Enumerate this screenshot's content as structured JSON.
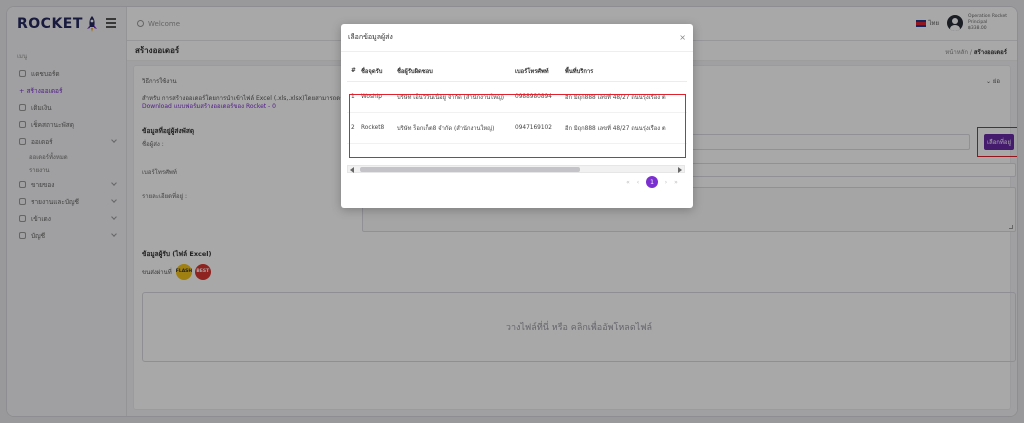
{
  "brand": {
    "name": "ROCKET"
  },
  "topbar": {
    "search_label": "Welcome",
    "language": "ไทย",
    "user": {
      "line1": "Operation Rocket",
      "line2": "Principal",
      "line3": "฿338.00"
    }
  },
  "sidebar": {
    "section_label": "เมนู",
    "items": [
      {
        "label": "แดชบอร์ด"
      },
      {
        "label": "+ สร้างออเดอร์"
      },
      {
        "label": "เติมเงิน"
      },
      {
        "label": "เช็คสถานะพัสดุ"
      },
      {
        "label": "ออเดอร์"
      },
      {
        "label": "ขายของ"
      },
      {
        "label": "รายงานและบัญชี"
      },
      {
        "label": "เข้าเดง"
      },
      {
        "label": "บัญชี"
      }
    ],
    "subitems": [
      {
        "label": "ออเดอร์ทั้งหมด"
      },
      {
        "label": "รายงาน"
      }
    ]
  },
  "main": {
    "page_title": "สร้างออเดอร์",
    "breadcrumb_home": "หน้าหลัก",
    "breadcrumb_current": "สร้างออเดอร์",
    "how_to_label": "วิธีการใช้งาน",
    "collapse_label": "ย่อ",
    "info_text": "สำหรับ การสร้างออเดอร์โดยการนำเข้าไฟล์ Excel (.xls,.xlsx)โดยสามารถดาวน์โหลด",
    "download_link": "Download แบบฟอร์มสร้างออเดอร์ของ Rocket - 0",
    "sender_section": "ข้อมูลที่อยู่ผู้ส่งพัสดุ",
    "sender_field": "ชื่อผู้ส่ง :",
    "select_button": "เลือกที่อยู่",
    "phone_field": "เบอร์โทรศัพท์",
    "address_field": "รายละเอียดที่อยู่ :",
    "receiver_section": "ข้อมูลผู้รับ (ไฟล์ Excel)",
    "carrier_label": "ขนส่งผ่านที่",
    "carriers": [
      {
        "label": "FLASH"
      },
      {
        "label": "BEST"
      }
    ],
    "dropzone_text": "วางไฟล์ที่นี่ หรือ คลิกเพื่ออัพโหลดไฟล์"
  },
  "modal": {
    "title": "เลือกข้อมูลผู้ส่ง",
    "close": "×",
    "columns": [
      "#",
      "ชื่อจุดรับ",
      "ชื่อผู้รับผิดชอบ",
      "เบอร์โทรศัพท์",
      "พื้นที่บริการ"
    ],
    "rows": [
      {
        "no": "1",
        "point": "Woship",
        "contact": "บริษัท เอ็นวิวินเนื่อยู จำกัด (สำนักงานใหญ่)",
        "phone": "0988980894",
        "area": "อีก มิถุก888 เลขที่ 48/27 ถนนรุ่งเรือง ต"
      },
      {
        "no": "2",
        "point": "Rocket8",
        "contact": "บริษัท ร็อกเก็ต8 จำกัด (สำนักงานใหญ่)",
        "phone": "0947169102",
        "area": "อีก มิถุก888 เลขที่ 48/27 ถนนรุ่งเรือง ต"
      }
    ],
    "pagination": {
      "current": "1"
    }
  },
  "colors": {
    "accent": "#7c2fd1",
    "highlight": "#e0202a",
    "button": "#6a2aa8"
  }
}
